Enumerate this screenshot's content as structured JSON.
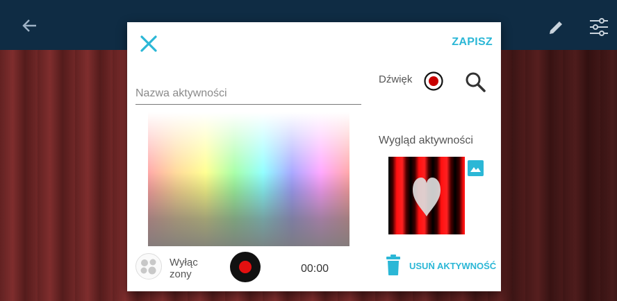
{
  "appbar": {
    "back_icon": "arrow-left-icon",
    "edit_icon": "pencil-icon",
    "settings_icon": "sliders-icon"
  },
  "dialog": {
    "close_icon": "close-icon",
    "save_label": "ZAPISZ",
    "name_placeholder": "Nazwa aktywności",
    "name_value": "",
    "toggle_zones_label_line1": "Wyłąc",
    "toggle_zones_label_line2": "zony",
    "timer": "00:00",
    "sound_label": "Dźwięk",
    "look_label": "Wygląd aktywności",
    "delete_label": "USUŃ AKTYWNOŚĆ",
    "accent_color": "#2bb7d6",
    "record_color": "#e41010"
  }
}
